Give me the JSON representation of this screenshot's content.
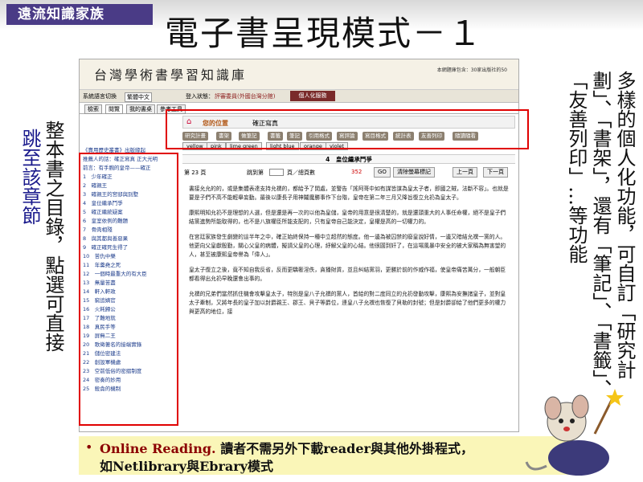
{
  "brand": "遠流知識家族",
  "slide_title": "電子書呈現模式－１",
  "left_label_1": "跳至該章節",
  "left_label_2": "整本書之目錄，點選可直接",
  "right_label": "多樣的個人化功能，可自訂「研究計劃」、「書架」，還有「筆記」、「書籤」、「友善列印」…等功能",
  "right_label_2": "「引用格式」、「寫評論」、",
  "app": {
    "logo": "台灣學術書學習知識庫",
    "top_right": "本網題庫包含：30家出版社的50",
    "nav_label": "系統語言切換",
    "nav_select": "繁體中文",
    "nav_login": "登入狀態：",
    "nav_user": "評審委員(外國台灣分館)",
    "personal": "個人化服務",
    "tabs": [
      "檢索",
      "閱覽",
      "我的書桌",
      "參考工具"
    ],
    "location_label": "您的位置",
    "location_value": "確正寫真",
    "tools": [
      "研究計畫",
      "書架",
      "做筆記",
      "書籤",
      "筆記",
      "引用格式",
      "寫評論",
      "寫目格式",
      "統計表",
      "友善列印",
      "隨讀隨看"
    ],
    "colors": [
      "yellow",
      "pink",
      "lime green",
      "light blue",
      "orange",
      "violet"
    ],
    "chapter": "4　皇位繼承鬥爭",
    "page_info": "第 23 頁",
    "jump": "跳到第",
    "jump_mid": "頁／總頁數",
    "total": "352",
    "go": "GO",
    "clear": "清除螢幕標記",
    "prev": "上一頁",
    "next": "下一頁",
    "toc_items": [
      "《賣用歷史叢書》出版緣起",
      "推薦人的話：確正寫真 正大光明",
      "前言：有手腕的皇帝——確正",
      "1　少年確正",
      "2　確親王",
      "3　確親王的宮邸與別墅",
      "4　皇位繼承鬥爭",
      "5　確正繼統疑案",
      "6　皇室依例的難題",
      "7　骨肉相殘",
      "8　與其都與善惡果",
      "9　確正確死生得了",
      "10　苦仇中樂",
      "11　年羹堯之死",
      "12　一個時最重大的有大臣",
      "13　無量苦盡",
      "14　軒入軒政",
      "15　窮追嫡官",
      "16　火耗歸公",
      "17　了難地就",
      "18　真民手等",
      "19　屏無二王",
      "20　歌徵著名的接端實錄",
      "21　儲位密建法",
      "22　創設軍機處",
      "23　空前低俗的密摺制度",
      "24　密奏的妙用",
      "25　殺貪的機制"
    ],
    "paragraphs": [
      "書接允允的的，或是集體表達支持允禩的，都給予了閒處，並警告「謠阿哥中如有謀皆謀為皇太子者，即國之賊，法斷不容」。也就是要是子們不高不能輕舉妄動。最後以康長子用神鬮魔勝事作下台階，皇帝在第二年三月又降旨復立允礽為皇太子。",
      "康熙明知允礽不是理想的人選，但是還是再一次的以他為皇儲，皇帝的用意是很清楚的，就是還頭重大的人事任命權，絕不是皇子們結黨進勢所能取得的，也不是八旗權臣所能支配的，只有皇帝自己能決定，皇權是高的一切權力的。",
      "在宮廷家族發生劇變的這半年之中，確正始終保持一種中立超然的態度。他一邊為被囚禁的廢皇說好情，一邊又暗結允禩一黨的人。他更向父皇獻殷勤，關心父皇的病體，擬請父皇的心理，紓解父皇的心結。他很圓到奸了，在這場風暴中安全的被大家稱為無害望的人，甚至被康熙皇帝譽為「偉人」。",
      "皇太子復立之後，竟不知自我反省，反而更驕奢淫佚，貪播財貨，並且糾結黨羽，更勝於前的作威作福，使皇帝痛苦萬分，一般朝臣都看得出允礽早晚還會出事的。",
      "允禩的兄弟們當然抓住機會攻擊皇太子，特別是皇八子允禩的黨人，首給的對二度同立的允礽發動攻擊，康熙為安撫諸皇子，並對皇太子牽制，又將年長的皇子加以封爵親王、郡王、貝子等爵位，連皇八子允禩也恢復了貝勒的封號；但是封爵卻給了他們更多的權力與更高的地位，接"
    ]
  },
  "note": {
    "bullet": "•",
    "highlight": "Online Reading.",
    "line1_rest": "讀者不需另外下載reader與其他外掛程式，",
    "line2": "如Netlibrary與Ebrary模式"
  },
  "colors": {
    "brand_bg": "#4a3b86",
    "highlight_box": "#e00000",
    "note_bg": "#faf6b8",
    "accent": "#8b0000"
  }
}
